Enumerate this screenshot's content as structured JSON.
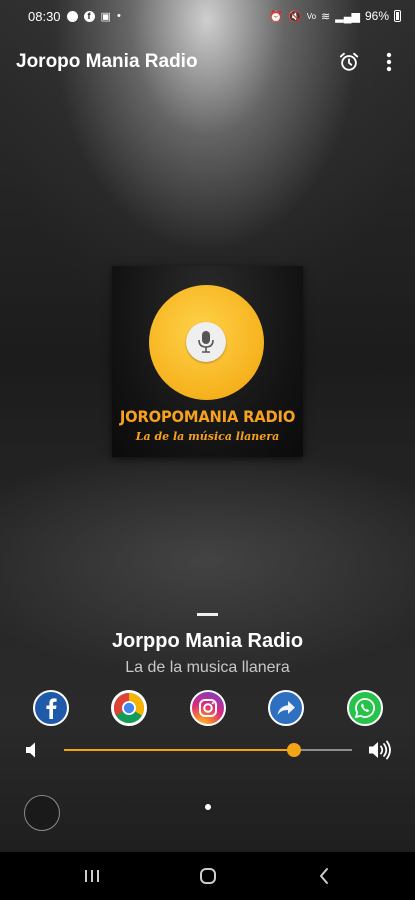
{
  "status_bar": {
    "time": "08:30",
    "battery": "96%",
    "icons": [
      "circle-notification-icon",
      "facebook-notification-icon",
      "gallery-icon",
      "dot-icon",
      "alarm-icon",
      "mute-icon",
      "volte-icon",
      "wifi-icon",
      "signal-icon",
      "battery-icon"
    ]
  },
  "app_bar": {
    "title": "Joropo Mania Radio",
    "actions": [
      "alarm-icon",
      "more-vert-icon"
    ]
  },
  "artwork": {
    "logo_title": "JOROPOMANIA RADIO",
    "logo_subtitle": "La de la música llanera",
    "accent_color": "#f6b21d"
  },
  "now_playing": {
    "separator": "---",
    "station_name": "Jorppo Mania Radio",
    "description": "La de la musica llanera"
  },
  "share": {
    "buttons": [
      "facebook",
      "chrome",
      "instagram",
      "share",
      "whatsapp"
    ]
  },
  "volume": {
    "level": 0.8,
    "accent_color": "#f2a515"
  },
  "nav_bar": {
    "buttons": [
      "recents",
      "home",
      "back"
    ]
  }
}
